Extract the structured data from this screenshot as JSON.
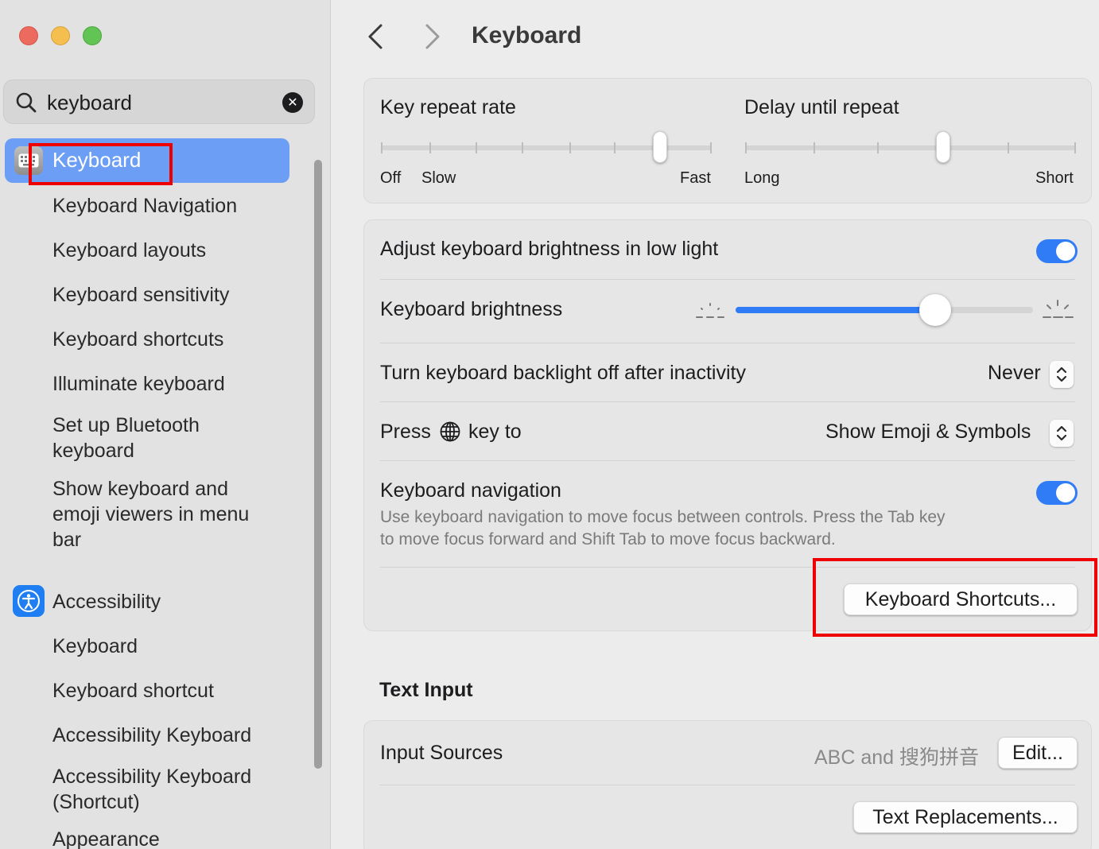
{
  "window": {
    "title": "Keyboard"
  },
  "sidebar": {
    "search": {
      "value": "keyboard",
      "placeholder": "Search"
    },
    "selected": {
      "label": "Keyboard"
    },
    "items": [
      {
        "label": "Keyboard Navigation"
      },
      {
        "label": "Keyboard layouts"
      },
      {
        "label": "Keyboard sensitivity"
      },
      {
        "label": "Keyboard shortcuts"
      },
      {
        "label": "Illuminate keyboard"
      },
      {
        "label_line1": "Set up Bluetooth",
        "label_line2": "keyboard"
      },
      {
        "label_line1": "Show keyboard and",
        "label_line2": "emoji viewers in menu",
        "label_line3": "bar"
      }
    ],
    "accessibility_group": {
      "label": "Accessibility",
      "items": [
        {
          "label": "Keyboard"
        },
        {
          "label": "Keyboard shortcut"
        },
        {
          "label": "Accessibility Keyboard"
        },
        {
          "label_line1": "Accessibility Keyboard",
          "label_line2": "(Shortcut)"
        },
        {
          "label": "Appearance"
        }
      ]
    }
  },
  "main": {
    "repeat": {
      "key_repeat_label": "Key repeat rate",
      "key_repeat_off": "Off",
      "key_repeat_slow": "Slow",
      "key_repeat_fast": "Fast",
      "key_repeat_level": 0.82,
      "delay_label": "Delay until repeat",
      "delay_long": "Long",
      "delay_short": "Short",
      "delay_level": 0.6
    },
    "brightness_auto": {
      "label": "Adjust keyboard brightness in low light",
      "on": true
    },
    "brightness": {
      "label": "Keyboard brightness",
      "level": 0.68
    },
    "backlight_off": {
      "label": "Turn keyboard backlight off after inactivity",
      "value": "Never"
    },
    "globe_key": {
      "label_prefix": "Press",
      "label_suffix": "key to",
      "value": "Show Emoji & Symbols"
    },
    "keyboard_nav": {
      "label": "Keyboard navigation",
      "on": true,
      "description_line1": "Use keyboard navigation to move focus between controls. Press the Tab key",
      "description_line2": "to move focus forward and Shift Tab to move focus backward."
    },
    "shortcuts_button": "Keyboard Shortcuts...",
    "text_input": {
      "title": "Text Input",
      "input_sources_label": "Input Sources",
      "input_sources_value": "ABC and 搜狗拼音",
      "edit_button": "Edit...",
      "replacements_button": "Text Replacements..."
    }
  },
  "colors": {
    "accent": "#2f7cf6",
    "sidebar_selected": "#6b9ef4",
    "annotation_red": "#ee0000"
  }
}
